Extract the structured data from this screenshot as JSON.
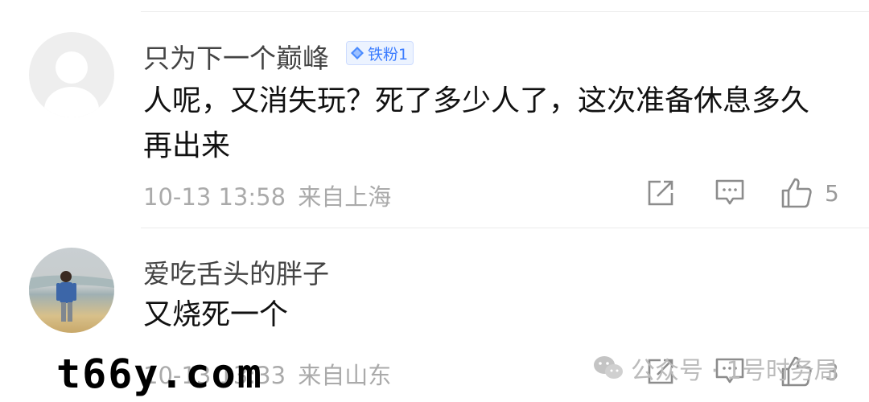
{
  "comments": [
    {
      "username": "只为下一个巅峰",
      "badge": "铁粉1",
      "text_lines": [
        "人呢，又消失玩？死了多少人了，这次准备休息多久",
        "再出来"
      ],
      "timestamp": "10-13 13:58",
      "location": "来自上海",
      "like_count": "5"
    },
    {
      "username": "爱吃舌头的胖子",
      "text_lines": [
        "又烧死一个"
      ],
      "timestamp": "10-13 13:33",
      "location": "来自山东",
      "like_count": "3"
    }
  ],
  "watermark": {
    "site": "t66y.com",
    "account": "公众号 · 1号时务局"
  }
}
